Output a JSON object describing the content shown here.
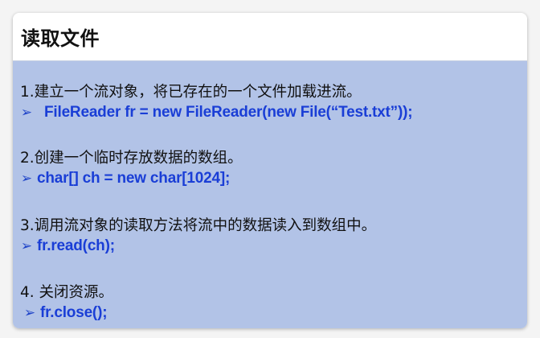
{
  "title": "读取文件",
  "colors": {
    "panel_background": "#b2c3e7",
    "code_text": "#1a3ed6",
    "step_text": "#111111"
  },
  "steps": [
    {
      "text": "1.建立一个流对象，将已存在的一个文件加载进流。",
      "code": "FileReader fr = new FileReader(new File(“Test.txt”));",
      "bullet_icon": "arrowhead-bullet"
    },
    {
      "text": "2.创建一个临时存放数据的数组。",
      "code": "char[] ch = new char[1024];",
      "bullet_icon": "arrowhead-bullet"
    },
    {
      "text": "3.调用流对象的读取方法将流中的数据读入到数组中。",
      "code": "fr.read(ch);",
      "bullet_icon": "arrowhead-bullet"
    },
    {
      "text": "4. 关闭资源。",
      "code": "fr.close();",
      "bullet_icon": "arrowhead-bullet"
    }
  ]
}
